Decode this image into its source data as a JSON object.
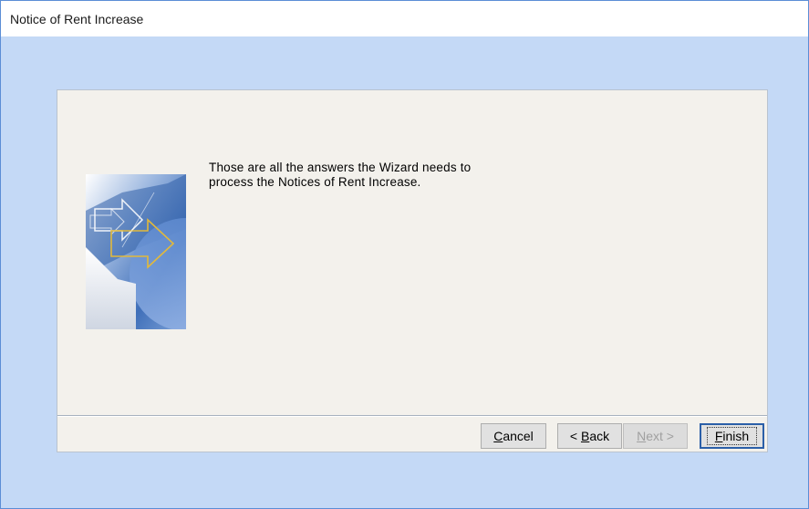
{
  "window": {
    "title": "Notice of Rent Increase"
  },
  "wizard": {
    "message_line1": "Those are all the answers the Wizard needs to",
    "message_line2": "process the Notices of Rent Increase."
  },
  "buttons": {
    "cancel": {
      "accel": "C",
      "rest": "ancel",
      "enabled": true
    },
    "back": {
      "prefix": "< ",
      "accel": "B",
      "rest": "ack",
      "enabled": true
    },
    "next": {
      "accel": "N",
      "rest": "ext >",
      "enabled": false
    },
    "finish": {
      "accel": "F",
      "rest": "inish",
      "enabled": true,
      "default": true
    }
  },
  "colors": {
    "desktop_background": "#c4d9f6",
    "dialog_background": "#f3f1ec",
    "accent_blue": "#2b5fa8",
    "arrow_gold": "#e2b93b"
  }
}
